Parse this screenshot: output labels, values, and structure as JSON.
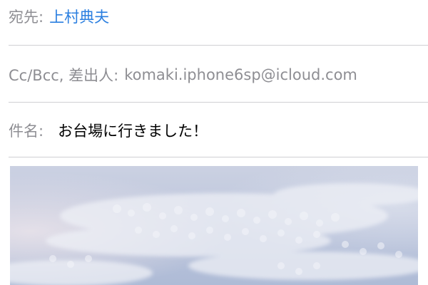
{
  "to": {
    "label": "宛先:",
    "recipient": "上村典夫"
  },
  "cc": {
    "label": "Cc/Bcc, 差出人:",
    "value": "komaki.iphone6sp@icloud.com"
  },
  "subject": {
    "label": "件名:",
    "value": "お台場に行きました！"
  },
  "attachment": {
    "icon": "photo-sky-clouds"
  },
  "colors": {
    "label": "#8e8e93",
    "recipient": "#2b7fe0",
    "subject": "#000000",
    "divider": "#cfcfd3"
  }
}
